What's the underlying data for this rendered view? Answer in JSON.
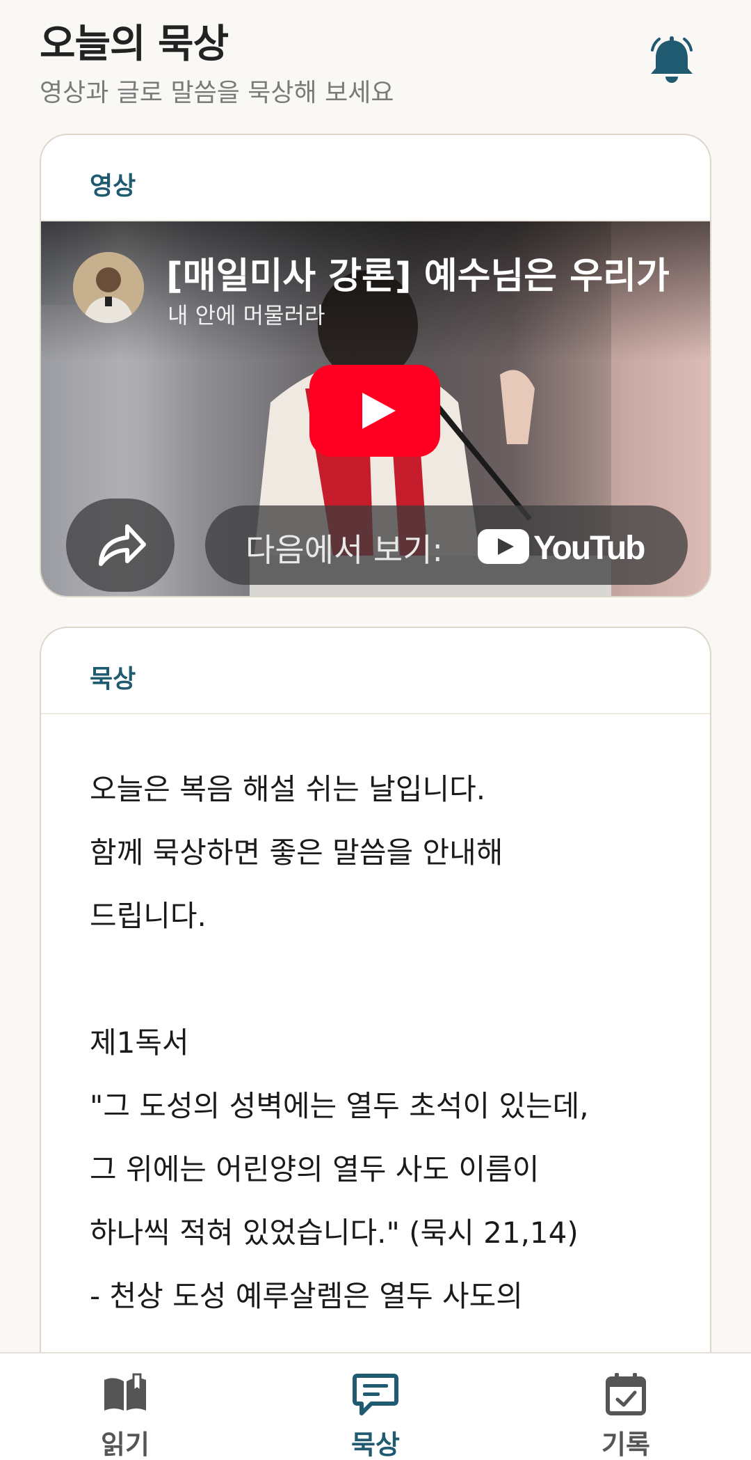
{
  "header": {
    "title": "오늘의 묵상",
    "subtitle": "영상과 글로 말씀을 묵상해 보세요",
    "notification_icon": "bell-icon"
  },
  "video_card": {
    "label": "영상",
    "video": {
      "title": "[매일미사 강론] 예수님은 우리가",
      "subtitle": "내 안에 머물러라",
      "watch_on_text": "다음에서 보기:",
      "youtube_logo_text": "YouTube",
      "play_icon": "play-icon",
      "share_icon": "share-icon"
    }
  },
  "meditation_card": {
    "label": "묵상",
    "lines": [
      "오늘은 복음 해설 쉬는 날입니다.",
      "함께 묵상하면 좋은 말씀을 안내해",
      "드립니다.",
      "",
      "제1독서",
      "\"그 도성의 성벽에는 열두 초석이 있는데,",
      "그 위에는 어린양의 열두 사도 이름이",
      "하나씩 적혀 있었습니다.\" (묵시 21,14)",
      "- 천상 도성 예루살렘은 열두 사도의"
    ]
  },
  "bottom_nav": {
    "items": [
      {
        "label": "읽기",
        "icon": "book-icon",
        "active": false
      },
      {
        "label": "묵상",
        "icon": "chat-icon",
        "active": true
      },
      {
        "label": "기록",
        "icon": "calendar-check-icon",
        "active": false
      }
    ]
  },
  "colors": {
    "accent": "#1f5a70",
    "inactive": "#555555",
    "background": "#faf8f4",
    "youtube_red": "#ff0022"
  }
}
